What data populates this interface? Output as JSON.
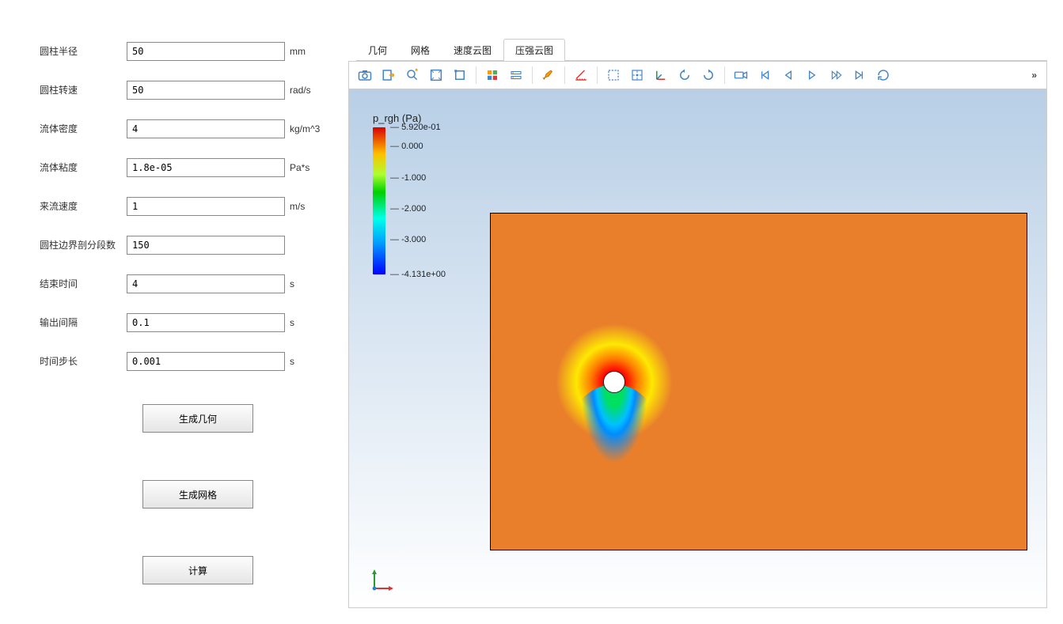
{
  "side": {
    "fields": [
      {
        "label": "圆柱半径",
        "value": "50",
        "unit": "mm"
      },
      {
        "label": "圆柱转速",
        "value": "50",
        "unit": "rad/s"
      },
      {
        "label": "流体密度",
        "value": "4",
        "unit": "kg/m^3"
      },
      {
        "label": "流体粘度",
        "value": "1.8e-05",
        "unit": "Pa*s"
      },
      {
        "label": "来流速度",
        "value": "1",
        "unit": "m/s"
      },
      {
        "label": "圆柱边界剖分段数",
        "value": "150",
        "unit": ""
      },
      {
        "label": "结束时间",
        "value": "4",
        "unit": "s"
      },
      {
        "label": "输出间隔",
        "value": "0.1",
        "unit": "s"
      },
      {
        "label": "时间步长",
        "value": "0.001",
        "unit": "s"
      }
    ],
    "buttons": {
      "gen_geom": "生成几何",
      "gen_mesh": "生成网格",
      "compute": "计算"
    }
  },
  "tabs": {
    "items": [
      {
        "label": "几何",
        "active": false
      },
      {
        "label": "网格",
        "active": false
      },
      {
        "label": "速度云图",
        "active": false
      },
      {
        "label": "压强云图",
        "active": true
      }
    ]
  },
  "toolbar": {
    "icons": [
      "camera",
      "export",
      "zoom",
      "fit",
      "select-box",
      "palette",
      "visibility",
      "brush",
      "ruler",
      "box-select",
      "center",
      "axes",
      "rotate-left",
      "rotate-right",
      "record",
      "first",
      "prev",
      "play",
      "next",
      "last",
      "loop"
    ],
    "overflow": "»"
  },
  "legend": {
    "title": "p_rgh (Pa)",
    "ticks": [
      "5.920e-01",
      "0.000",
      "-1.000",
      "-2.000",
      "-3.000",
      "-4.131e+00"
    ]
  },
  "chart_data": {
    "type": "heatmap",
    "title": "p_rgh (Pa)",
    "variable": "p_rgh",
    "unit": "Pa",
    "colorbar": {
      "min": -4.131,
      "max": 0.592,
      "ticks": [
        0.592,
        0.0,
        -1.0,
        -2.0,
        -3.0,
        -4.131
      ]
    },
    "geometry": "2D rectangular domain with internal circular cylinder (flow around rotating cylinder)"
  }
}
